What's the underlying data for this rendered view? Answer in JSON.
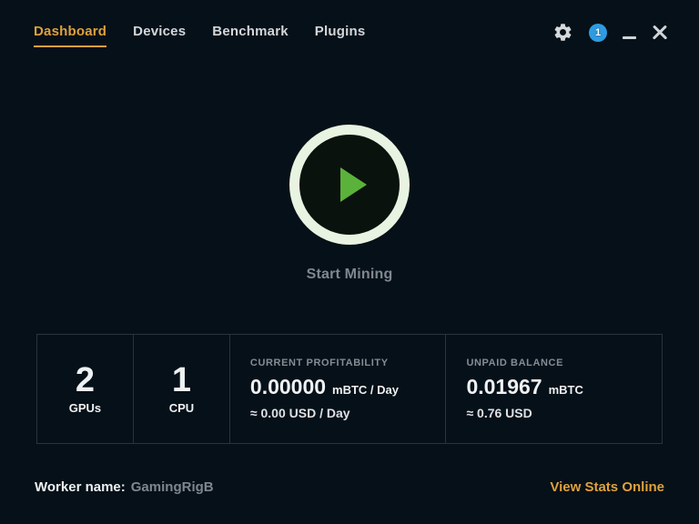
{
  "nav": {
    "tabs": [
      {
        "label": "Dashboard",
        "active": true
      },
      {
        "label": "Devices",
        "active": false
      },
      {
        "label": "Benchmark",
        "active": false
      },
      {
        "label": "Plugins",
        "active": false
      }
    ]
  },
  "titlebar": {
    "notification_count": "1"
  },
  "mining": {
    "start_label": "Start Mining"
  },
  "stats": {
    "gpus": {
      "value": "2",
      "label": "GPUs"
    },
    "cpu": {
      "value": "1",
      "label": "CPU"
    },
    "profitability": {
      "label": "CURRENT PROFITABILITY",
      "value": "0.00000",
      "unit": "mBTC / Day",
      "fiat": "≈ 0.00 USD / Day"
    },
    "balance": {
      "label": "UNPAID BALANCE",
      "value": "0.01967",
      "unit": "mBTC",
      "fiat": "≈ 0.76 USD"
    }
  },
  "footer": {
    "worker_label": "Worker name:",
    "worker_name": "GamingRigB",
    "stats_link": "View Stats Online"
  },
  "colors": {
    "background": "#061018",
    "accent_orange": "#dfa13d",
    "badge_blue": "#2e9be2",
    "play_green": "#5bb23b",
    "play_ring": "#e9f3e1",
    "panel_border": "#2b333b",
    "text_primary": "#eef1f3",
    "text_muted": "#848c94"
  }
}
